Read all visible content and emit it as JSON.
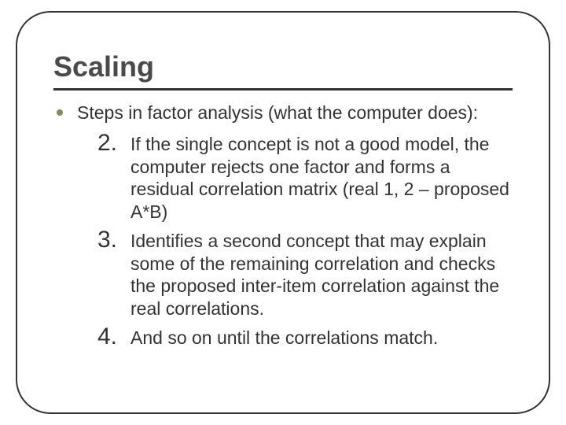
{
  "title": "Scaling",
  "lead": "Steps in factor analysis (what the computer does):",
  "steps": [
    {
      "num": "2.",
      "text": "If the single concept is not a good model, the computer rejects one factor and forms a residual correlation matrix (real 1, 2 – proposed A*B)"
    },
    {
      "num": "3.",
      "text": "Identifies a second concept that may explain some of the remaining correlation and checks the proposed inter-item correlation against the real correlations."
    },
    {
      "num": "4.",
      "text": "And so on until the correlations match."
    }
  ]
}
